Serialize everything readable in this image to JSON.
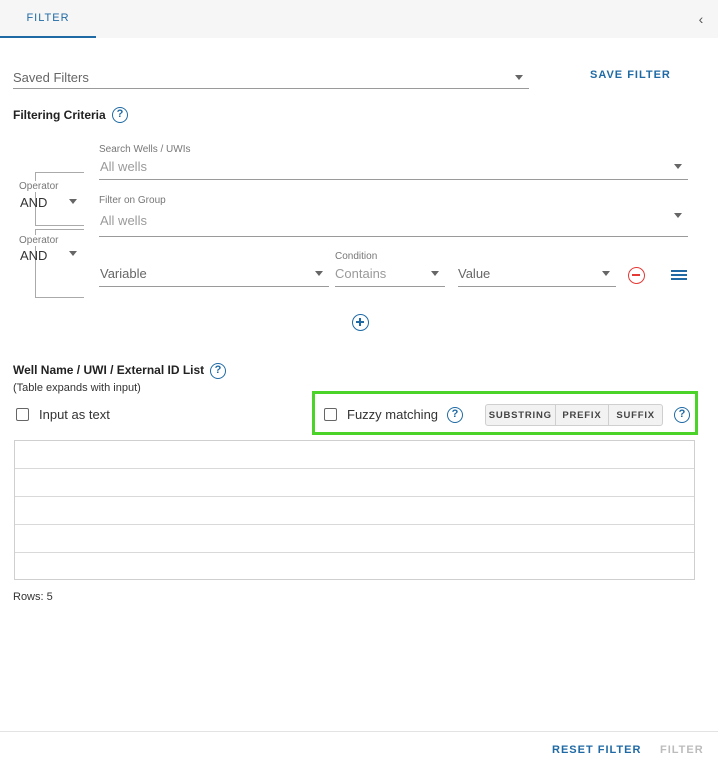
{
  "tab": {
    "label": "FILTER"
  },
  "saved_filters": {
    "placeholder": "Saved Filters",
    "save_label": "SAVE FILTER"
  },
  "criteria": {
    "heading": "Filtering Criteria",
    "operator_label": "Operator",
    "operators": [
      "AND",
      "AND"
    ],
    "search_wells": {
      "label": "Search Wells / UWIs",
      "value": "All wells"
    },
    "filter_group": {
      "label": "Filter on Group",
      "value": "All wells"
    },
    "variable": {
      "placeholder": "Variable"
    },
    "condition": {
      "label": "Condition",
      "value": "Contains"
    },
    "value": {
      "placeholder": "Value"
    }
  },
  "list": {
    "heading": "Well Name / UWI / External ID List",
    "subheading": "(Table expands with input)",
    "input_as_text": "Input as text",
    "fuzzy_matching": "Fuzzy matching",
    "modes": [
      "SUBSTRING",
      "PREFIX",
      "SUFFIX"
    ],
    "rows_label": "Rows: 5",
    "rows": [
      "",
      "",
      "",
      "",
      ""
    ]
  },
  "footer": {
    "reset_label": "RESET FILTER",
    "filter_label": "FILTER"
  },
  "colors": {
    "accent": "#1f6aa5",
    "highlight": "#4cd32a",
    "danger": "#e53935"
  },
  "icons": {
    "help": "?",
    "collapse": "‹"
  }
}
